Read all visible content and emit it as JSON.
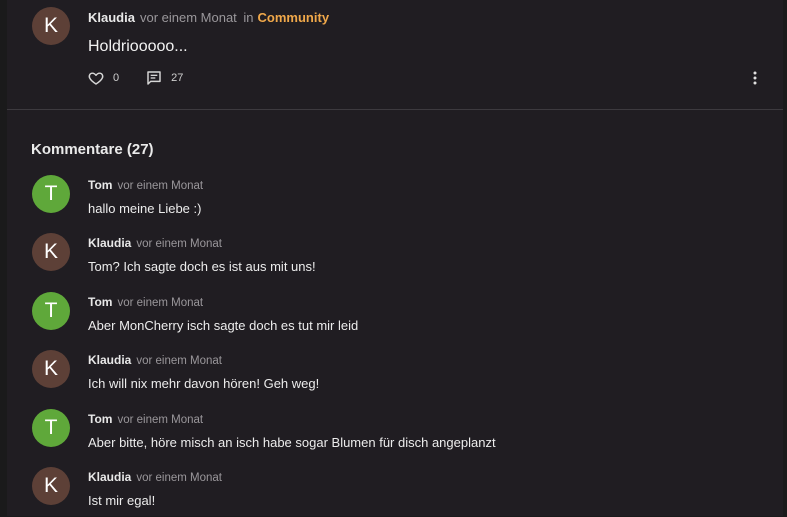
{
  "post": {
    "avatar_letter": "K",
    "author": "Klaudia",
    "time": "vor einem Monat",
    "in_label": "in",
    "community": "Community",
    "body": "Holdriooooo...",
    "likes": "0",
    "comments": "27"
  },
  "comments_section": {
    "title": "Kommentare (27)"
  },
  "comments": [
    {
      "avatar_letter": "T",
      "avatar_color": "#5fa83a",
      "author": "Tom",
      "time": "vor einem Monat",
      "text": "hallo meine Liebe :)"
    },
    {
      "avatar_letter": "K",
      "avatar_color": "#5d4037",
      "author": "Klaudia",
      "time": "vor einem Monat",
      "text": "Tom? Ich sagte doch es ist aus mit uns!"
    },
    {
      "avatar_letter": "T",
      "avatar_color": "#5fa83a",
      "author": "Tom",
      "time": "vor einem Monat",
      "text": "Aber MonCherry isch sagte doch es tut mir leid"
    },
    {
      "avatar_letter": "K",
      "avatar_color": "#5d4037",
      "author": "Klaudia",
      "time": "vor einem Monat",
      "text": "Ich will nix mehr davon hören! Geh weg!"
    },
    {
      "avatar_letter": "T",
      "avatar_color": "#5fa83a",
      "author": "Tom",
      "time": "vor einem Monat",
      "text": "Aber bitte, höre misch an isch habe sogar Blumen für disch angeplanzt"
    },
    {
      "avatar_letter": "K",
      "avatar_color": "#5d4037",
      "author": "Klaudia",
      "time": "vor einem Monat",
      "text": "Ist mir egal!"
    }
  ],
  "colors": {
    "community_accent": "#f0a84a",
    "klaudia_avatar": "#5d4037",
    "tom_avatar": "#5fa83a"
  },
  "icons": [
    "heart-icon",
    "comment-icon",
    "more-vertical-icon"
  ]
}
